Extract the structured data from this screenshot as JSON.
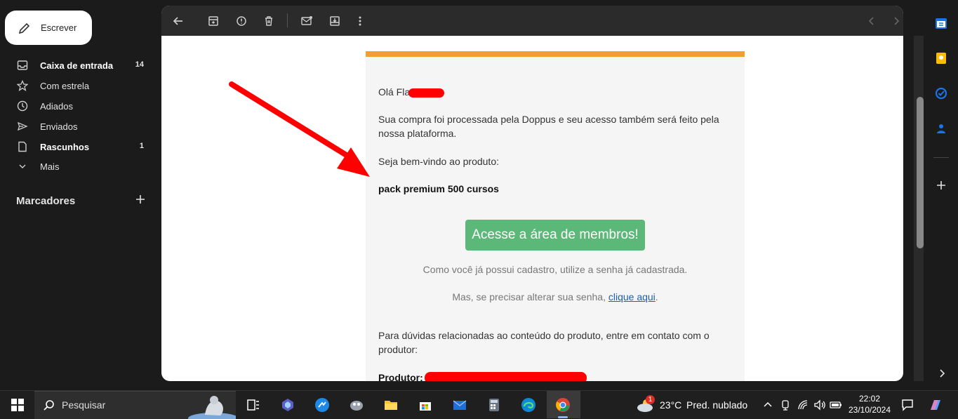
{
  "nav": {
    "compose_label": "Escrever",
    "items": [
      {
        "label": "Caixa de entrada",
        "count": "14",
        "bold": true
      },
      {
        "label": "Com estrela",
        "count": ""
      },
      {
        "label": "Adiados",
        "count": ""
      },
      {
        "label": "Enviados",
        "count": ""
      },
      {
        "label": "Rascunhos",
        "count": "1",
        "bold": true
      },
      {
        "label": "Mais",
        "count": ""
      }
    ],
    "labels_title": "Marcadores"
  },
  "email": {
    "greeting": "Olá Fla",
    "paragraph1": "Sua compra foi processada pela Doppus e seu acesso também será feito pela nossa plataforma.",
    "welcome": "Seja bem-vindo ao produto:",
    "product": "pack premium 500 cursos",
    "cta_label": "Acesse a área de membros!",
    "note": "Como você já possui cadastro, utilize a senha já cadastrada.",
    "reset_prefix": "Mas, se precisar alterar sua senha, ",
    "reset_link": "clique aqui",
    "reset_suffix": ".",
    "contact": "Para dúvidas relacionadas ao conteúdo do produto, entre em contato com o produtor:",
    "producer_label": "Produtor:"
  },
  "taskbar": {
    "search_placeholder": "Pesquisar",
    "weather_temp": "23°C",
    "weather_desc": "Pred. nublado",
    "weather_badge": "1",
    "time": "22:02",
    "date": "23/10/2024"
  },
  "colors": {
    "accent_bar": "#f0a030",
    "cta": "#5cb878",
    "annotation_arrow": "#ff0000"
  }
}
